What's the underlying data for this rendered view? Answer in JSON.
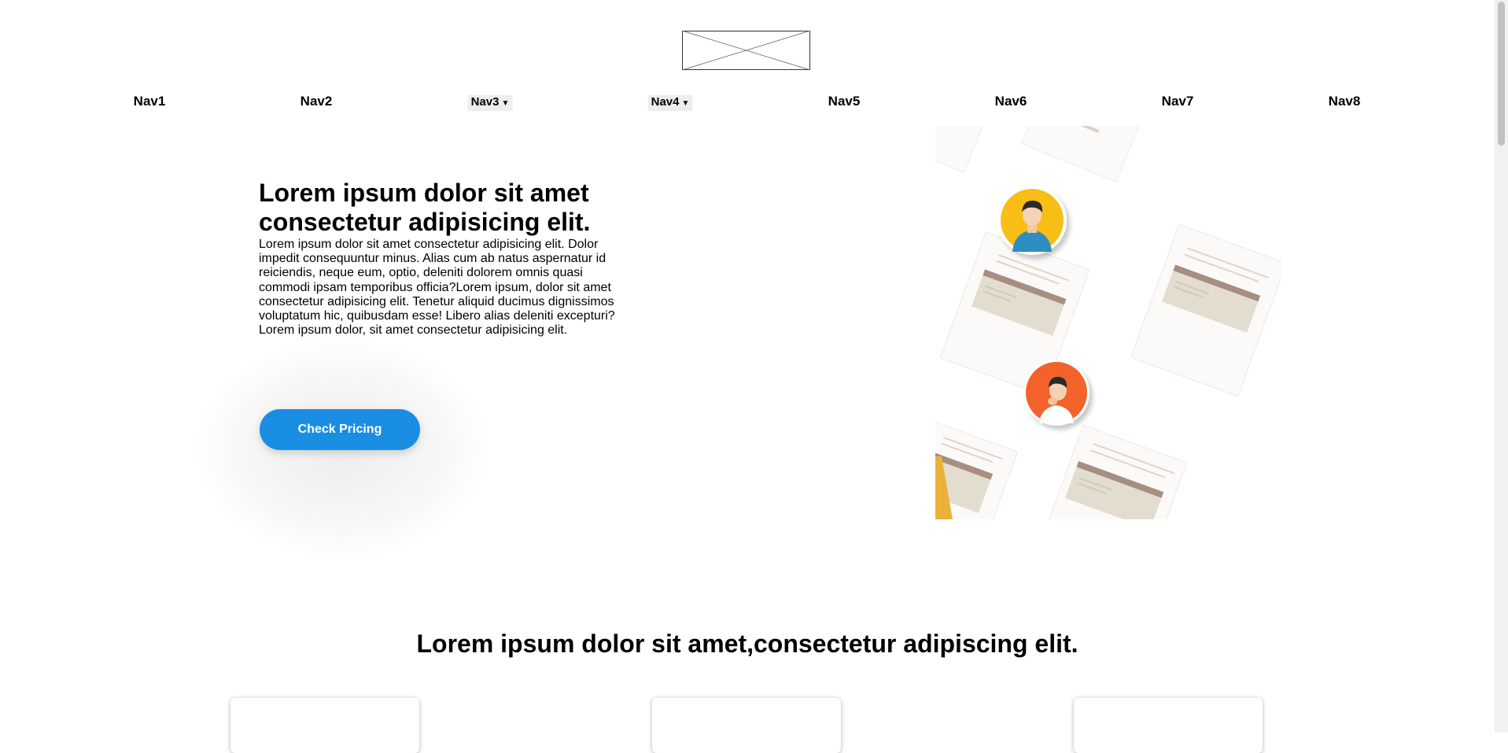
{
  "logo": {
    "alt": "logo placeholder"
  },
  "nav": {
    "items": [
      {
        "label": "Nav1",
        "type": "link"
      },
      {
        "label": "Nav2",
        "type": "link"
      },
      {
        "label": "Nav3",
        "type": "dropdown"
      },
      {
        "label": "Nav4",
        "type": "dropdown"
      },
      {
        "label": "Nav5",
        "type": "link"
      },
      {
        "label": "Nav6",
        "type": "link"
      },
      {
        "label": "Nav7",
        "type": "link"
      },
      {
        "label": "Nav8",
        "type": "link"
      }
    ]
  },
  "hero": {
    "title": "Lorem ipsum dolor sit amet consectetur adipisicing elit.",
    "body": "Lorem ipsum dolor sit amet consectetur adipisicing elit. Dolor impedit consequuntur minus. Alias cum ab natus aspernatur id reiciendis, neque eum, optio, deleniti dolorem omnis quasi commodi ipsam temporibus officia?Lorem ipsum, dolor sit amet consectetur adipisicing elit. Tenetur aliquid ducimus dignissimos voluptatum hic, quibusdam esse! Libero alias deleniti excepturi? Lorem ipsum dolor, sit amet consectetur adipisicing elit.",
    "cta_label": "Check Pricing"
  },
  "section": {
    "title": "Lorem ipsum dolor sit amet,consectetur adipiscing elit."
  },
  "colors": {
    "cta": "#1a8ee2",
    "avatar_yellow": "#f8be15",
    "avatar_orange": "#f2622b",
    "doc_brown": "#a68e80",
    "doc_beige": "#e3ddcf"
  }
}
